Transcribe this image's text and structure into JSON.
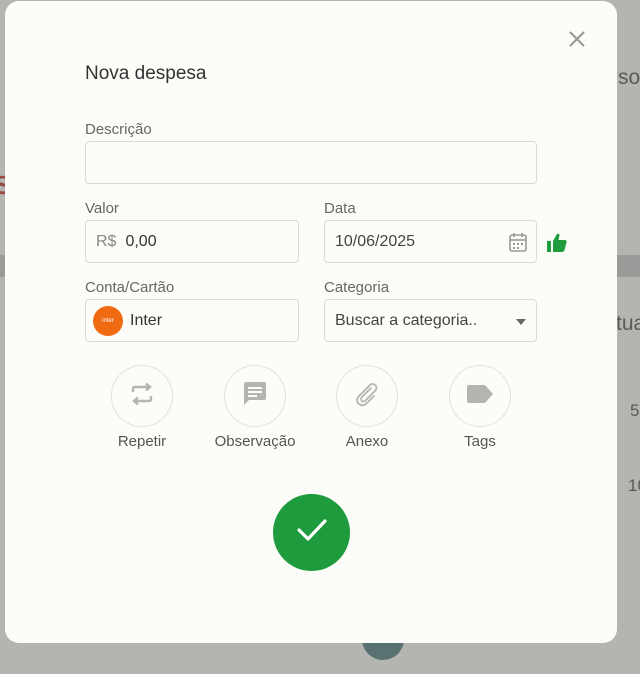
{
  "modal": {
    "title": "Nova despesa",
    "close_icon": "close-icon"
  },
  "form": {
    "descricao": {
      "label": "Descrição",
      "value": ""
    },
    "valor": {
      "label": "Valor",
      "prefix": "R$",
      "value": "0,00"
    },
    "data": {
      "label": "Data",
      "value": "10/06/2025",
      "icon": "calendar-icon",
      "status_icon": "thumbs-up-icon"
    },
    "conta": {
      "label": "Conta/Cartão",
      "bank_logo_text": "inter",
      "value": "Inter"
    },
    "categoria": {
      "label": "Categoria",
      "placeholder": "Buscar a categoria.."
    }
  },
  "actions": [
    {
      "label": "Repetir",
      "icon": "repeat-icon"
    },
    {
      "label": "Observação",
      "icon": "note-icon"
    },
    {
      "label": "Anexo",
      "icon": "paperclip-icon"
    },
    {
      "label": "Tags",
      "icon": "tag-icon"
    }
  ],
  "confirm": {
    "icon": "check-icon"
  },
  "background": {
    "text1": "so",
    "text2": "tua",
    "text3": "5",
    "text4": "10",
    "text5": "S"
  },
  "colors": {
    "primary": "#1e9b3d",
    "bank": "#f06a12"
  }
}
